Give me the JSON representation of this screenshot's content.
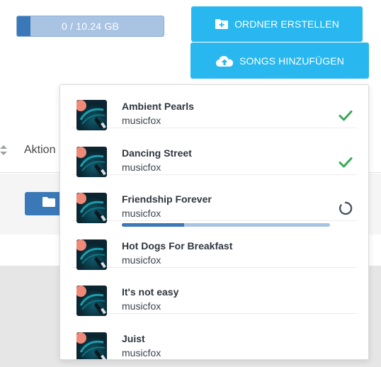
{
  "storage": {
    "label": "0 / 10.24 GB",
    "used_fraction": 0.09
  },
  "toolbar": {
    "create_folder_label": "ORDNER ERSTELLEN",
    "add_songs_label": "SONGS HINZUFÜGEN"
  },
  "table": {
    "action_header": "Aktion"
  },
  "colors": {
    "accent": "#28b7ee",
    "primary": "#3a78b8",
    "success": "#3aa85a",
    "progress_track": "#a9c3e3"
  },
  "uploads": {
    "items": [
      {
        "title": "Ambient Pearls",
        "artist": "musicfox",
        "status": "done",
        "status_icon": "check-icon"
      },
      {
        "title": "Dancing Street",
        "artist": "musicfox",
        "status": "done",
        "status_icon": "check-icon"
      },
      {
        "title": "Friendship Forever",
        "artist": "musicfox",
        "status": "uploading",
        "status_icon": "spinner-icon",
        "progress": 0.3
      },
      {
        "title": "Hot Dogs For Breakfast",
        "artist": "musicfox",
        "status": "pending"
      },
      {
        "title": "It's not easy",
        "artist": "musicfox",
        "status": "pending"
      },
      {
        "title": "Juist",
        "artist": "musicfox",
        "status": "pending"
      }
    ]
  }
}
